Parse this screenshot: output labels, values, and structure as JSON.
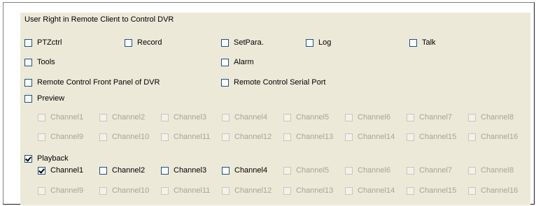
{
  "group": {
    "title": "User Right in Remote Client to Control DVR"
  },
  "rights": [
    {
      "label": "PTZctrl",
      "checked": false
    },
    {
      "label": "Record",
      "checked": false
    },
    {
      "label": "SetPara.",
      "checked": false
    },
    {
      "label": "Log",
      "checked": false
    },
    {
      "label": "Talk",
      "checked": false
    },
    {
      "label": "Tools",
      "checked": false
    },
    {
      "label": "Alarm",
      "checked": false
    },
    {
      "label": "Remote Control Front Panel of DVR",
      "checked": false
    },
    {
      "label": "Remote Control Serial Port",
      "checked": false
    }
  ],
  "preview": {
    "label": "Preview",
    "checked": false,
    "channels": [
      {
        "label": "Channel1",
        "checked": false,
        "enabled": false
      },
      {
        "label": "Channel2",
        "checked": false,
        "enabled": false
      },
      {
        "label": "Channel3",
        "checked": false,
        "enabled": false
      },
      {
        "label": "Channel4",
        "checked": false,
        "enabled": false
      },
      {
        "label": "Channel5",
        "checked": false,
        "enabled": false
      },
      {
        "label": "Channel6",
        "checked": false,
        "enabled": false
      },
      {
        "label": "Channel7",
        "checked": false,
        "enabled": false
      },
      {
        "label": "Channel8",
        "checked": false,
        "enabled": false
      },
      {
        "label": "Channel9",
        "checked": false,
        "enabled": false
      },
      {
        "label": "Channel10",
        "checked": false,
        "enabled": false
      },
      {
        "label": "Channel11",
        "checked": false,
        "enabled": false
      },
      {
        "label": "Channel12",
        "checked": false,
        "enabled": false
      },
      {
        "label": "Channel13",
        "checked": false,
        "enabled": false
      },
      {
        "label": "Channel14",
        "checked": false,
        "enabled": false
      },
      {
        "label": "Channel15",
        "checked": false,
        "enabled": false
      },
      {
        "label": "Channel16",
        "checked": false,
        "enabled": false
      }
    ]
  },
  "playback": {
    "label": "Playback",
    "checked": true,
    "channels": [
      {
        "label": "Channel1",
        "checked": true,
        "enabled": true
      },
      {
        "label": "Channel2",
        "checked": false,
        "enabled": true
      },
      {
        "label": "Channel3",
        "checked": false,
        "enabled": true
      },
      {
        "label": "Channel4",
        "checked": false,
        "enabled": true
      },
      {
        "label": "Channel5",
        "checked": false,
        "enabled": false
      },
      {
        "label": "Channel6",
        "checked": false,
        "enabled": false
      },
      {
        "label": "Channel7",
        "checked": false,
        "enabled": false
      },
      {
        "label": "Channel8",
        "checked": false,
        "enabled": false
      },
      {
        "label": "Channel9",
        "checked": false,
        "enabled": false
      },
      {
        "label": "Channel10",
        "checked": false,
        "enabled": false
      },
      {
        "label": "Channel11",
        "checked": false,
        "enabled": false
      },
      {
        "label": "Channel12",
        "checked": false,
        "enabled": false
      },
      {
        "label": "Channel13",
        "checked": false,
        "enabled": false
      },
      {
        "label": "Channel14",
        "checked": false,
        "enabled": false
      },
      {
        "label": "Channel15",
        "checked": false,
        "enabled": false
      },
      {
        "label": "Channel16",
        "checked": false,
        "enabled": false
      }
    ]
  }
}
